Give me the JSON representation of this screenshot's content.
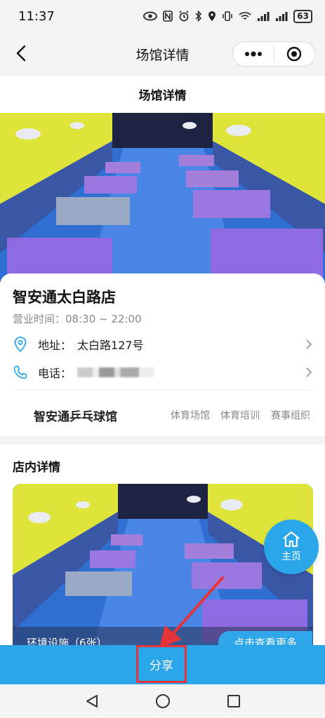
{
  "status_bar": {
    "time": "11:37",
    "battery": "63",
    "icons": [
      "eye-icon",
      "nfc-icon",
      "alarm-icon",
      "bluetooth-icon",
      "location-icon",
      "vibrate-icon",
      "wifi-icon",
      "signal-icon",
      "signal-icon",
      "battery-icon"
    ]
  },
  "nav": {
    "title": "场馆详情",
    "back_icon": "back-arrow-icon",
    "more_icon": "more-dots-icon",
    "close_icon": "target-close-icon"
  },
  "venue": {
    "section_title": "场馆详情",
    "name": "智安通太白路店",
    "hours_label": "营业时间：",
    "hours_value": "08:30 ~ 22:00",
    "address_label": "地址：",
    "address_value": "太白路127号",
    "phone_label": "电话：",
    "brand": "智安通乒乓球馆",
    "tags": [
      "体育场馆",
      "体育培训",
      "赛事组织"
    ]
  },
  "store": {
    "section_title": "店内详情",
    "photo_caption": "环境设施（6张）",
    "more_label": "点击查看更多"
  },
  "home_button": {
    "label": "主页",
    "icon": "home-icon"
  },
  "share_button": {
    "label": "分享"
  },
  "colors": {
    "accent": "#2aa6ea",
    "highlight": "#e5343a",
    "background": "#f3f3f3"
  }
}
